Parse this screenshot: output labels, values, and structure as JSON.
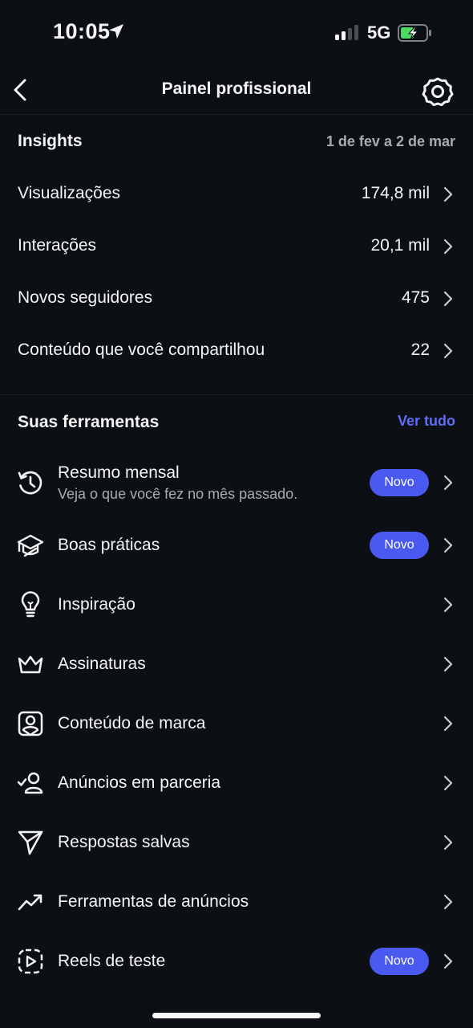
{
  "status_bar": {
    "time": "10:05",
    "network": "5G"
  },
  "nav": {
    "title": "Painel profissional"
  },
  "insights": {
    "title": "Insights",
    "date_range": "1 de fev a 2 de mar",
    "metrics": [
      {
        "label": "Visualizações",
        "value": "174,8 mil"
      },
      {
        "label": "Interações",
        "value": "20,1 mil"
      },
      {
        "label": "Novos seguidores",
        "value": "475"
      },
      {
        "label": "Conteúdo que você compartilhou",
        "value": "22"
      }
    ]
  },
  "tools": {
    "title": "Suas ferramentas",
    "see_all": "Ver tudo",
    "items": [
      {
        "label": "Resumo mensal",
        "subtitle": "Veja o que você fez no mês passado.",
        "badge": "Novo",
        "icon": "history-icon"
      },
      {
        "label": "Boas práticas",
        "badge": "Novo",
        "icon": "graduation-cap-icon"
      },
      {
        "label": "Inspiração",
        "icon": "lightbulb-icon"
      },
      {
        "label": "Assinaturas",
        "icon": "crown-icon"
      },
      {
        "label": "Conteúdo de marca",
        "icon": "branded-content-icon"
      },
      {
        "label": "Anúncios em parceria",
        "icon": "partner-check-icon"
      },
      {
        "label": "Respostas salvas",
        "icon": "paper-plane-icon"
      },
      {
        "label": "Ferramentas de anúncios",
        "icon": "trending-up-icon"
      },
      {
        "label": "Reels de teste",
        "badge": "Novo",
        "icon": "trial-reels-icon"
      }
    ]
  },
  "colors": {
    "background": "#0c1014",
    "accent": "#5d6df5",
    "badge": "#4a5af0",
    "secondary_text": "#a8acb2"
  }
}
